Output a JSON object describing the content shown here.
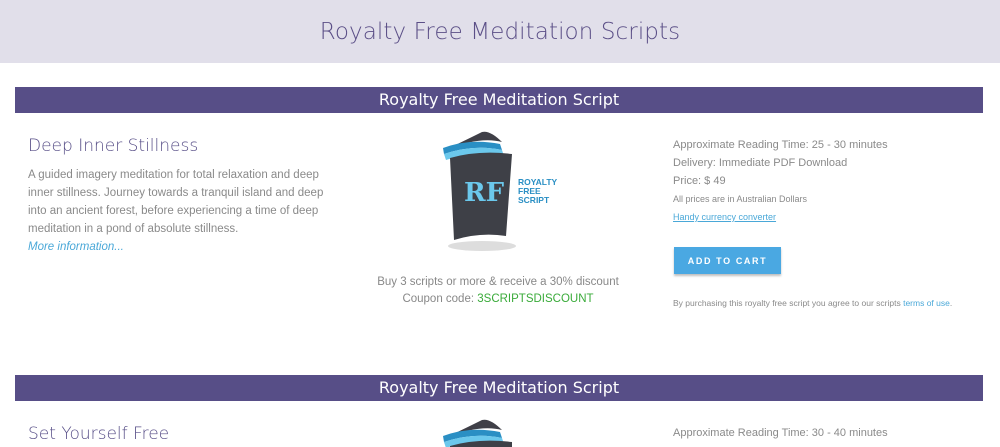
{
  "header": {
    "title": "Royalty Free Meditation Scripts"
  },
  "products": [
    {
      "banner": "Royalty Free Meditation Script",
      "title": "Deep Inner Stillness",
      "description": "A guided imagery meditation for total relaxation and deep inner stillness. Journey towards a tranquil island and deep into an ancient forest, before experiencing a time of deep meditation in a pond of absolute stillness.",
      "more_link": "More information...",
      "logo": {
        "mark": "RF",
        "line1": "ROYALTY",
        "line2": "FREE",
        "line3": "SCRIPT",
        "icon": "rf-logo-icon"
      },
      "promo_line": "Buy 3 scripts or more & receive a 30% discount",
      "coupon_label": "Coupon code: ",
      "coupon_code": "3SCRIPTSDISCOUNT",
      "reading_time": "Approximate Reading Time: 25 - 30 minutes",
      "delivery": "Delivery: Immediate PDF Download",
      "price": "Price: $ 49",
      "currency_note": "All prices are in Australian Dollars",
      "currency_link": "Handy currency converter",
      "cart_label": "ADD TO CART",
      "terms_text": "By purchasing this royalty free script you agree to our scripts ",
      "terms_link": "terms of use",
      "terms_end": "."
    },
    {
      "banner": "Royalty Free Meditation Script",
      "title": "Set Yourself Free",
      "reading_time": "Approximate Reading Time: 30 - 40 minutes"
    }
  ],
  "colors": {
    "accent": "#574e87",
    "header_bg": "#e1dfea",
    "link": "#4aa8d8",
    "button": "#4aa8e2",
    "coupon": "#3aab3a"
  }
}
